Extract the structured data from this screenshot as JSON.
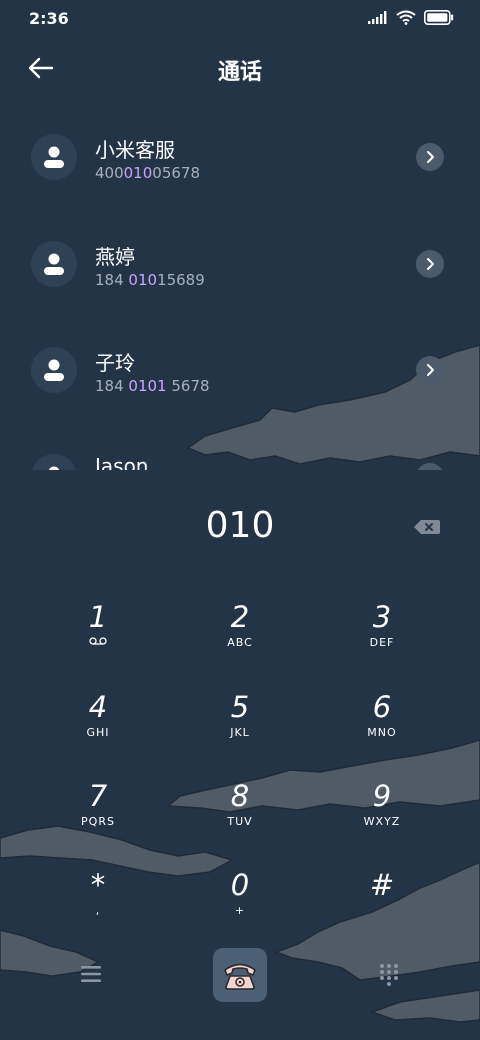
{
  "status_bar": {
    "time": "2:36",
    "icons": [
      "signal-icon",
      "wifi-icon",
      "battery-icon"
    ]
  },
  "header": {
    "title": "通话",
    "back_icon": "arrow-left-icon"
  },
  "contacts": [
    {
      "name": "小米客服",
      "number_parts": [
        "400",
        "010",
        "05678"
      ]
    },
    {
      "name": "燕婷",
      "number_parts": [
        "184 ",
        "010",
        "15689"
      ]
    },
    {
      "name": "子玲",
      "number_parts": [
        "184 ",
        "0101",
        " 5678"
      ]
    },
    {
      "name": "Jason",
      "number_parts": [
        "",
        "",
        ""
      ]
    }
  ],
  "dialer": {
    "input": "010",
    "keys": [
      {
        "digit": "1",
        "letters": ""
      },
      {
        "digit": "2",
        "letters": "ABC"
      },
      {
        "digit": "3",
        "letters": "DEF"
      },
      {
        "digit": "4",
        "letters": "GHI"
      },
      {
        "digit": "5",
        "letters": "JKL"
      },
      {
        "digit": "6",
        "letters": "MNO"
      },
      {
        "digit": "7",
        "letters": "PQRS"
      },
      {
        "digit": "8",
        "letters": "TUV"
      },
      {
        "digit": "9",
        "letters": "WXYZ"
      },
      {
        "digit": "*",
        "letters": ","
      },
      {
        "digit": "0",
        "letters": "+"
      },
      {
        "digit": "#",
        "letters": ""
      }
    ]
  },
  "colors": {
    "background": "#243447",
    "highlight": "#c9a4ff",
    "secondary_text": "#a6b0bc"
  }
}
